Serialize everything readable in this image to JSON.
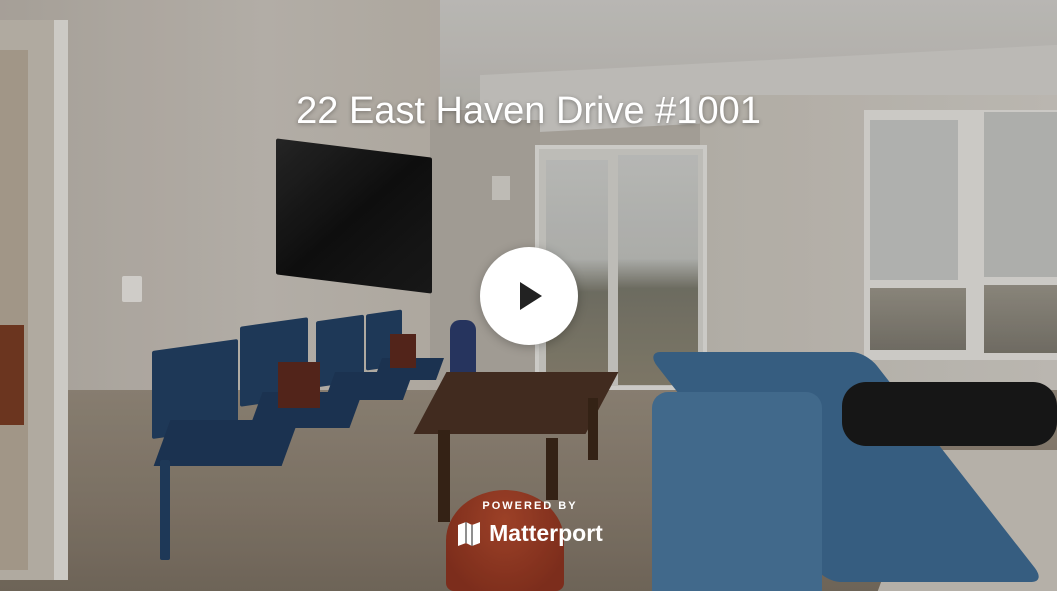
{
  "tour": {
    "title": "22 East Haven Drive #1001"
  },
  "player": {
    "play_icon": "play-icon"
  },
  "branding": {
    "powered_by": "POWERED BY",
    "name": "Matterport",
    "logo_icon": "matterport-logo-icon"
  },
  "colors": {
    "overlay_text": "#ffffff",
    "play_button_bg": "#ffffff",
    "play_icon": "#222222"
  }
}
